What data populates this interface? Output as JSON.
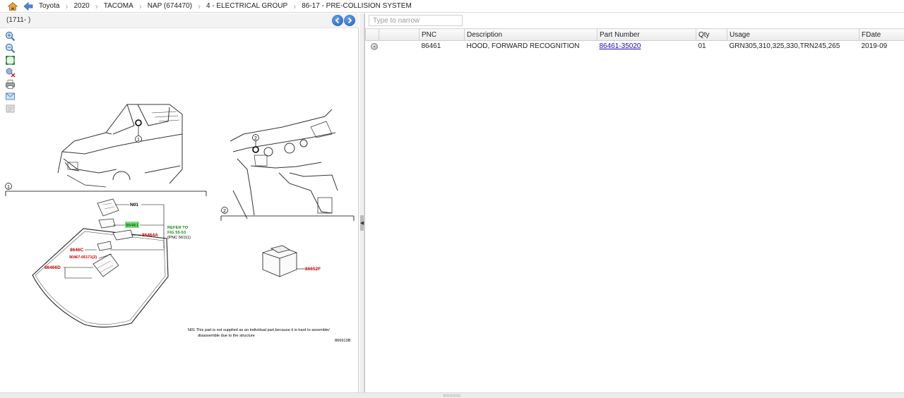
{
  "breadcrumb": {
    "items": [
      "Toyota",
      "2020",
      "TACOMA",
      "NAP (674470)",
      "4 - ELECTRICAL GROUP",
      "86-17 - PRE-COLLISION SYSTEM"
    ],
    "home_icon": "home-icon",
    "back_icon": "back-arrow-icon",
    "separator": "›"
  },
  "left_panel": {
    "figure_label": "(1711- )",
    "toolbar": [
      "zoom-in-icon",
      "zoom-out-icon",
      "fit-to-screen-icon",
      "clear-highlight-icon",
      "print-icon",
      "email-icon",
      "copy-icon"
    ],
    "diagram": {
      "callouts": [
        "1",
        "2"
      ],
      "section_labels": [
        "1",
        "2"
      ],
      "part_labels": [
        "N01",
        "86461",
        "86464A",
        "8646C",
        "90467-05171(2)",
        "86466D",
        "86652F"
      ],
      "refer": [
        "REFER TO",
        "FIG 55-53",
        "(PNC 56111)"
      ],
      "note_line1": "N01  This part is not supplied as an individual part,because it is hard to assemble/",
      "note_line2": "disassemble due to the structure",
      "figure_id": "866913B"
    }
  },
  "right_panel": {
    "filter_placeholder": "Type to narrow",
    "filter_value": "",
    "columns": [
      "",
      "",
      "PNC",
      "Description",
      "Part Number",
      "Qty",
      "Usage",
      "FDate"
    ],
    "rows": [
      {
        "pnc": "86461",
        "description": "HOOD, FORWARD RECOGNITION",
        "part_number": "86461-35020",
        "qty": "01",
        "usage": "GRN305,310,325,330,TRN245,265",
        "fdate": "2019-09"
      }
    ]
  },
  "colors": {
    "accent": "#1f5db8",
    "part_label_red": "#c00000",
    "part_label_green": "#1a8c1a",
    "highlight": "#7de07d"
  }
}
